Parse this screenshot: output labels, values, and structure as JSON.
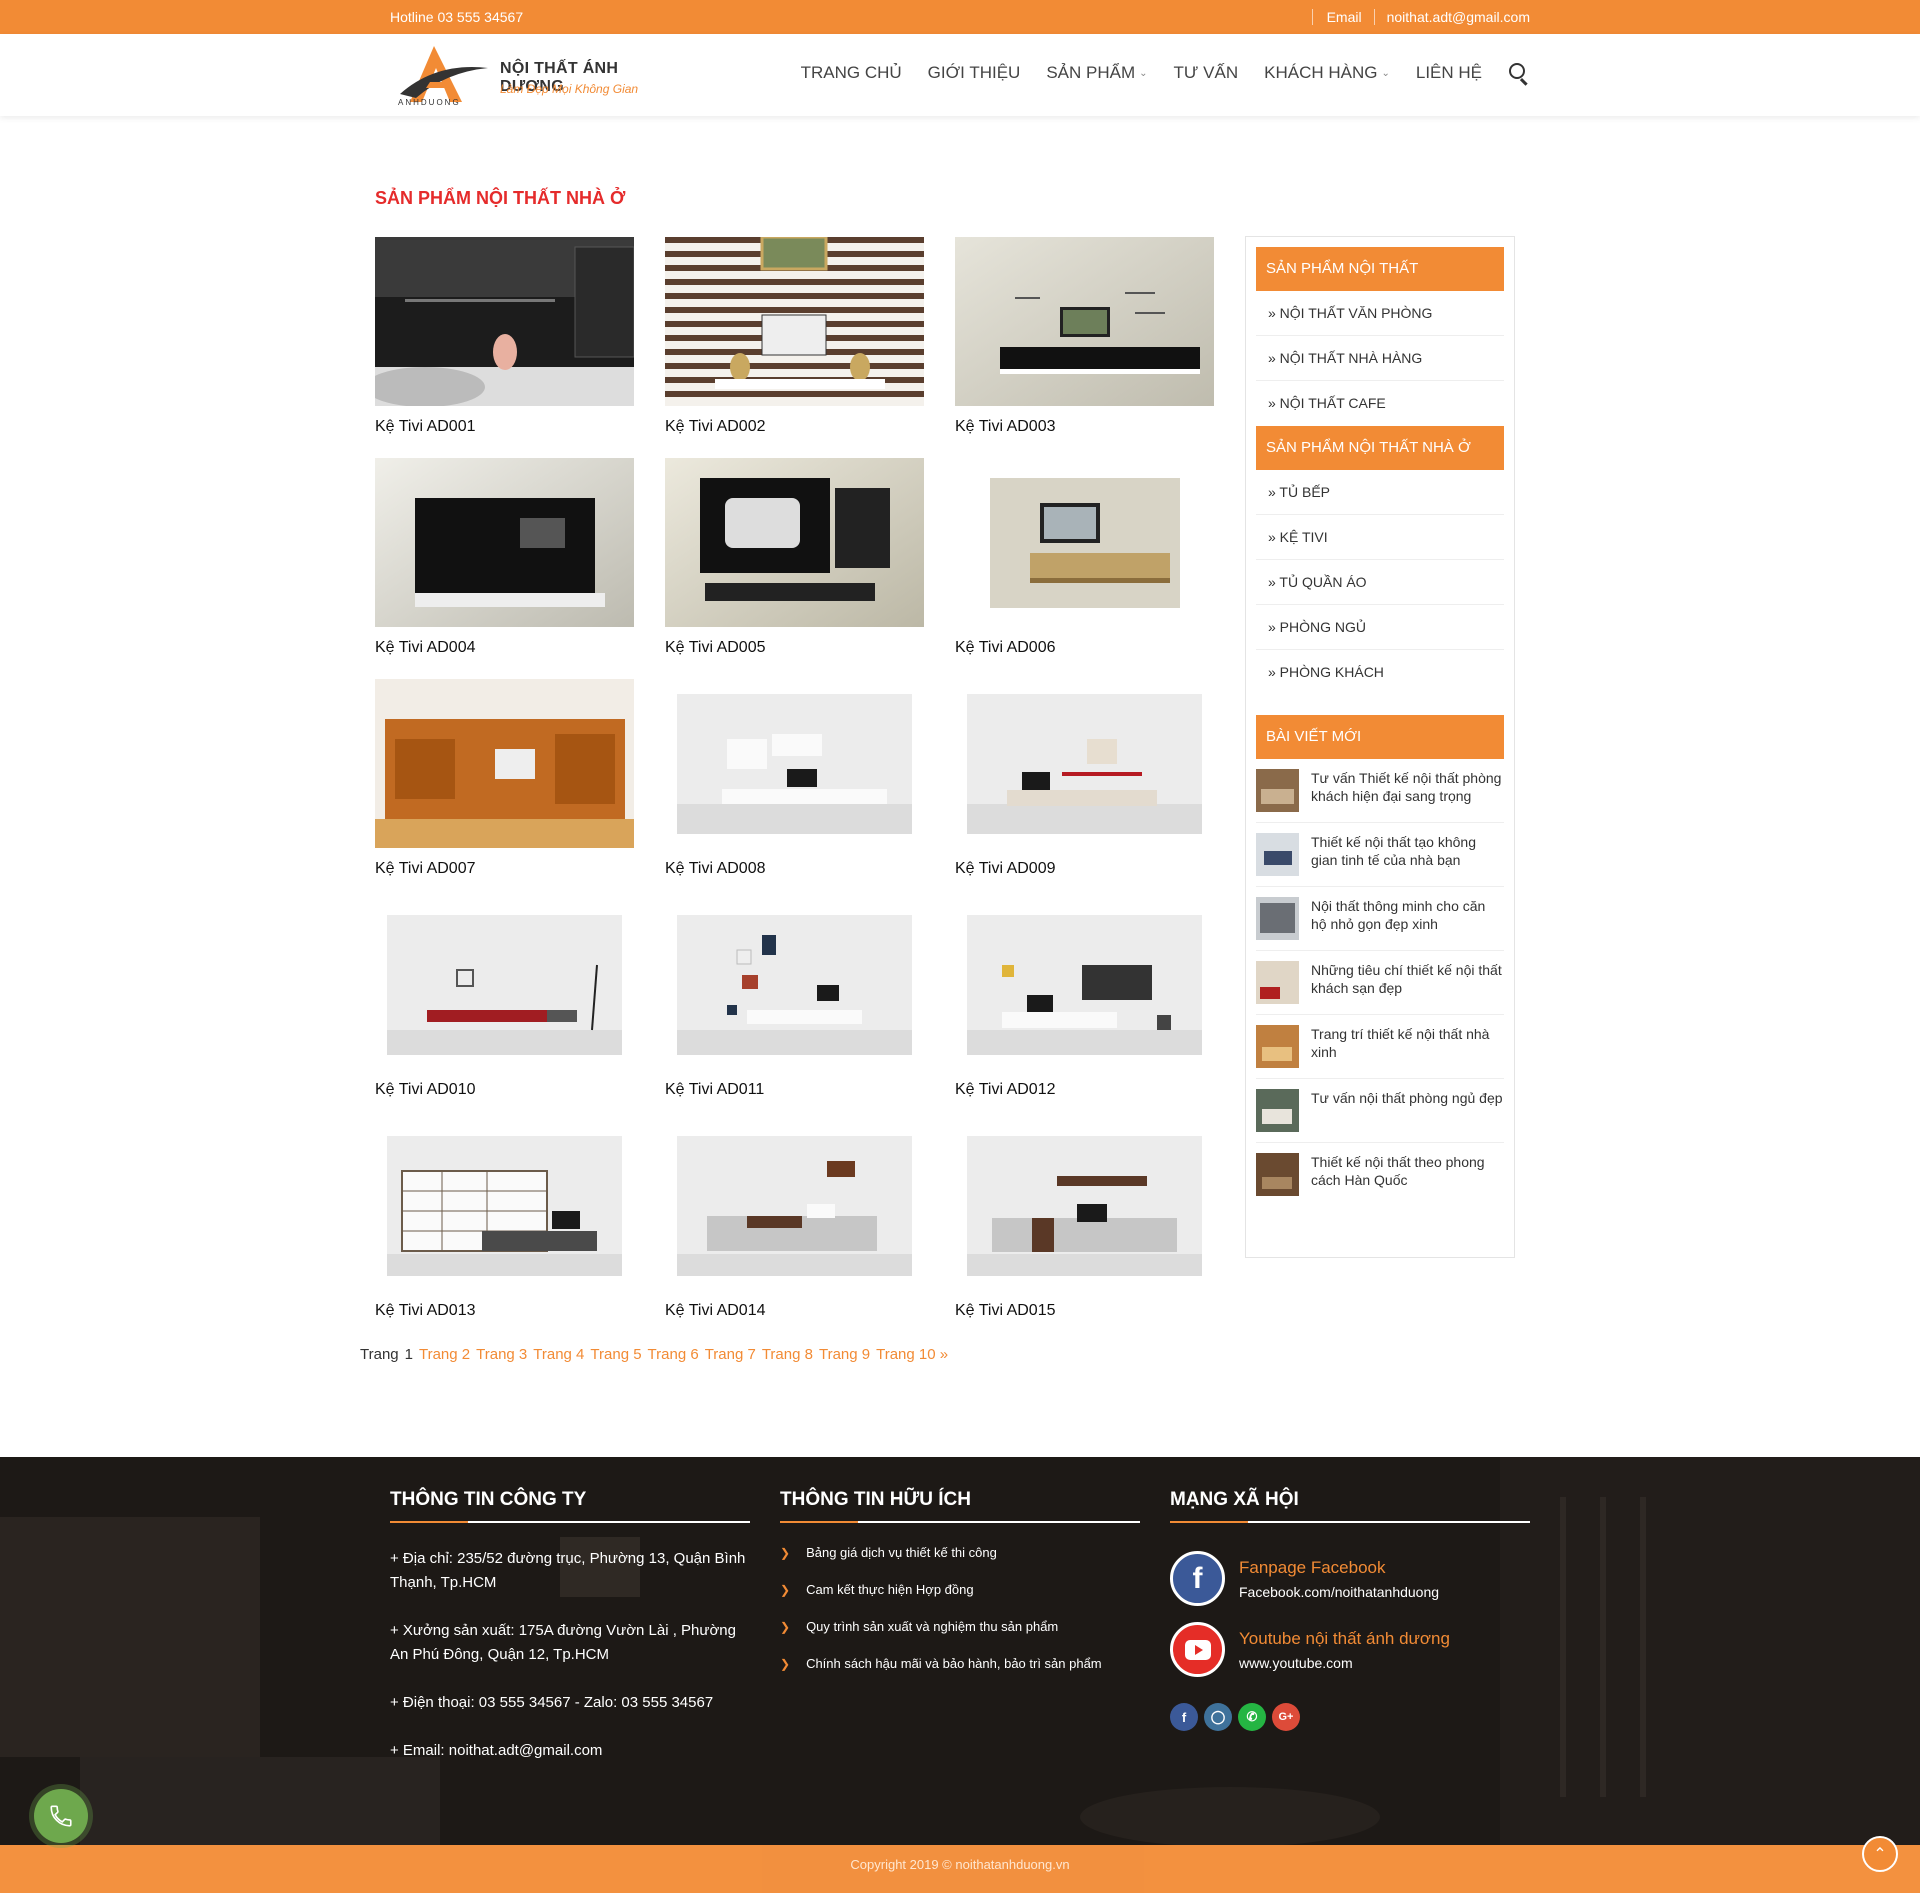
{
  "topbar": {
    "hotline": "Hotline 03 555 34567",
    "email_label": "Email",
    "email": "noithat.adt@gmail.com"
  },
  "header": {
    "brand": "NỘI THẤT ÁNH DƯƠNG",
    "slogan": "Làm Đẹp Mọi Không Gian",
    "logo_small": "ANHDUONG",
    "nav": [
      "TRANG CHỦ",
      "GIỚI THIỆU",
      "SẢN PHẨM",
      "TƯ VẤN",
      "KHÁCH HÀNG",
      "LIÊN HỆ"
    ]
  },
  "main": {
    "title": "SẢN PHẨM NỘI THẤT NHÀ Ở",
    "products": [
      "Kệ Tivi AD001",
      "Kệ Tivi AD002",
      "Kệ Tivi AD003",
      "Kệ Tivi AD004",
      "Kệ Tivi AD005",
      "Kệ Tivi AD006",
      "Kệ Tivi AD007",
      "Kệ Tivi AD008",
      "Kệ Tivi AD009",
      "Kệ Tivi AD010",
      "Kệ Tivi AD011",
      "Kệ Tivi AD012",
      "Kệ Tivi AD013",
      "Kệ Tivi AD014",
      "Kệ Tivi AD015"
    ],
    "pagination": {
      "label": "Trang",
      "current": "1",
      "pages": [
        "Trang 2",
        "Trang 3",
        "Trang 4",
        "Trang 5",
        "Trang 6",
        "Trang 7",
        "Trang 8",
        "Trang 9",
        "Trang 10 »"
      ]
    }
  },
  "sidebar": {
    "head1": "SẢN PHẨM NỘI THẤT",
    "list1": [
      "» NỘI THẤT VĂN PHÒNG",
      "» NỘI THẤT NHÀ HÀNG",
      "» NỘI THẤT CAFE"
    ],
    "head2": "SẢN PHẨM NỘI THẤT NHÀ Ở",
    "list2": [
      "» TỦ BẾP",
      "» KỆ TIVI",
      "» TỦ QUẦN ÁO",
      "» PHÒNG NGỦ",
      "» PHÒNG KHÁCH"
    ],
    "head3": "BÀI VIẾT MỚI",
    "posts": [
      "Tư vấn Thiết kế nội thất phòng khách hiện đại sang trọng",
      "Thiết kế nội thất tạo không gian tinh tế của nhà bạn",
      "Nội thất thông minh cho căn hộ nhỏ gọn đẹp xinh",
      "Những tiêu chí thiết kế nội thất khách sạn đẹp",
      "Trang trí thiết kế nội thất nhà xinh",
      "Tư vấn nội thất phòng ngủ đẹp",
      "Thiết kế nội thất theo phong cách Hàn Quốc"
    ]
  },
  "footer": {
    "company_title": "THÔNG TIN CÔNG TY",
    "address": "+ Địa chỉ: 235/52 đường trục, Phường 13, Quận Bình Thạnh, Tp.HCM",
    "factory": "+ Xưởng sản xuất: 175A đường Vườn Lài , Phường An Phú Đông, Quận 12, Tp.HCM",
    "phone": "+ Điện thoại: 03 555 34567   - Zalo: 03 555 34567",
    "email": "+ Email: noithat.adt@gmail.com",
    "useful_title": "THÔNG TIN HỮU ÍCH",
    "useful": [
      "Bảng giá dịch vụ thiết kế thi công",
      "Cam kết thực hiện Hợp đồng",
      "Quy trình sản xuất và nghiệm thu sản phẩm",
      "Chính sách hậu mãi và bảo hành, bảo trì sản phẩm"
    ],
    "social_title": "MẠNG XÃ HỘI",
    "facebook_title": "Fanpage Facebook",
    "facebook_url": "Facebook.com/noithatanhduong",
    "youtube_title": "Youtube nội thất ánh dương",
    "youtube_url": "www.youtube.com",
    "copyright": "Copyright 2019 © noithatanhduong.vn"
  },
  "colors": {
    "accent": "#f28b35",
    "title_red": "#e52b2b"
  }
}
